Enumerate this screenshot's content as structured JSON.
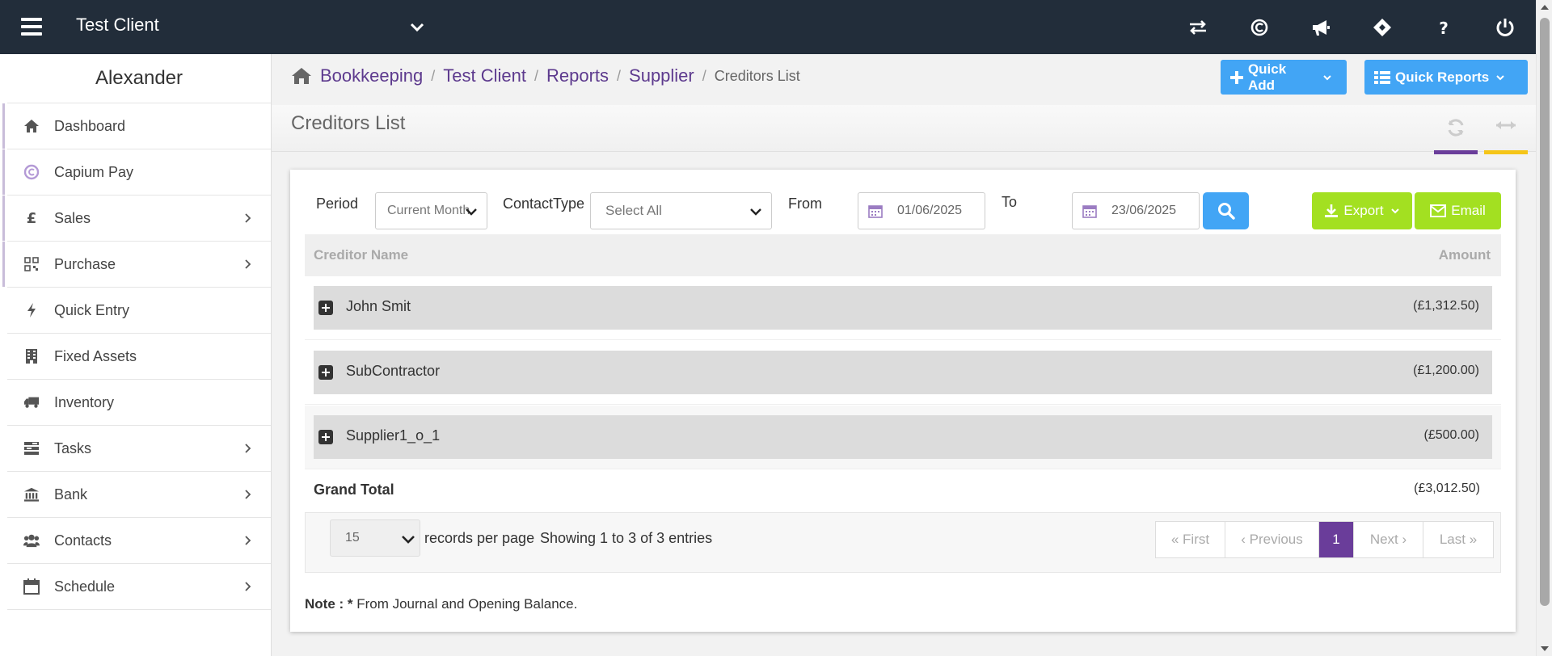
{
  "topbar": {
    "client": "Test Client",
    "icons": [
      "transfer-icon",
      "capium-icon",
      "megaphone-icon",
      "ticket-icon",
      "help-icon",
      "power-icon"
    ]
  },
  "sidebar": {
    "user": "Alexander",
    "items": [
      {
        "label": "Dashboard",
        "icon": "home-icon",
        "chevron": false
      },
      {
        "label": "Capium Pay",
        "icon": "capium-pay-icon",
        "chevron": false
      },
      {
        "label": "Sales",
        "icon": "pound-icon",
        "chevron": true
      },
      {
        "label": "Purchase",
        "icon": "qrcode-icon",
        "chevron": true
      },
      {
        "label": "Quick Entry",
        "icon": "bolt-icon",
        "chevron": false
      },
      {
        "label": "Fixed Assets",
        "icon": "building-icon",
        "chevron": false
      },
      {
        "label": "Inventory",
        "icon": "truck-icon",
        "chevron": false
      },
      {
        "label": "Tasks",
        "icon": "tasks-icon",
        "chevron": true
      },
      {
        "label": "Bank",
        "icon": "bank-icon",
        "chevron": true
      },
      {
        "label": "Contacts",
        "icon": "users-icon",
        "chevron": true
      },
      {
        "label": "Schedule",
        "icon": "calendar-icon",
        "chevron": true
      }
    ]
  },
  "breadcrumb": {
    "items": [
      "Bookkeeping",
      "Test Client",
      "Reports",
      "Supplier"
    ],
    "current": "Creditors List"
  },
  "header": {
    "quick_add": "Quick Add",
    "quick_reports": "Quick Reports",
    "title": "Creditors List"
  },
  "filters": {
    "period_label": "Period",
    "period_value": "Current Month",
    "contact_type_label": "ContactType",
    "contact_type_value": "Select All",
    "from_label": "From",
    "from_value": "01/06/2025",
    "to_label": "To",
    "to_value": "23/06/2025",
    "export_label": "Export",
    "email_label": "Email"
  },
  "table": {
    "col_name": "Creditor Name",
    "col_amount": "Amount",
    "rows": [
      {
        "name": "John Smit",
        "amount": "(£1,312.50)"
      },
      {
        "name": "SubContractor",
        "amount": "(£1,200.00)"
      },
      {
        "name": "Supplier1_o_1",
        "amount": "(£500.00)"
      }
    ],
    "grand_total_label": "Grand Total",
    "grand_total_value": "(£3,012.50)"
  },
  "pagination": {
    "per_page": "15",
    "per_page_label": "records per page",
    "info": "Showing 1 to 3 of 3 entries",
    "first": "« First",
    "previous": "‹ Previous",
    "current": "1",
    "next": "Next ›",
    "last": "Last »"
  },
  "note": {
    "prefix": "Note : *",
    "text": " From Journal and Opening Balance."
  },
  "colors": {
    "topbar": "#222d3a",
    "accent_purple": "#6a3d9a",
    "button_blue": "#42a5f5",
    "button_green": "#a3e021"
  }
}
